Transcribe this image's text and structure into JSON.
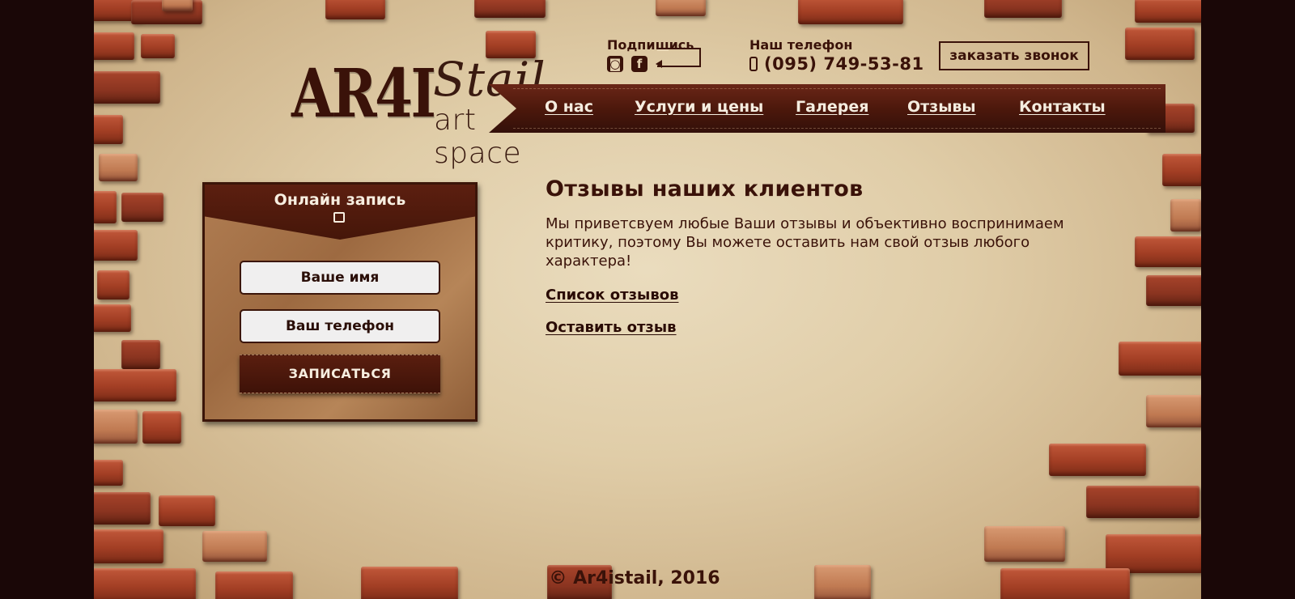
{
  "logo": {
    "main": "AR4I",
    "stail": "Stail",
    "sub": "art space"
  },
  "subscribe": {
    "title": "Подпишись",
    "icons": [
      "instagram-icon",
      "facebook-icon"
    ],
    "instagram_glyph": "◙",
    "facebook_glyph": "f"
  },
  "contact": {
    "title": "Наш телефон",
    "number": "(095) 749-53-81"
  },
  "callback_label": "заказать звонок",
  "nav": {
    "items": [
      {
        "label": "О нас"
      },
      {
        "label": "Услуги и цены"
      },
      {
        "label": "Галерея"
      },
      {
        "label": "Отзывы"
      },
      {
        "label": "Контакты"
      }
    ]
  },
  "form": {
    "title": "Онлайн запись",
    "name_placeholder": "Ваше имя",
    "phone_placeholder": "Ваш телефон",
    "submit_label": "ЗАПИСАТЬСЯ"
  },
  "content": {
    "title": "Отзывы наших клиентов",
    "text": "Мы приветсвуем любые Ваши отзывы и объективно воспринимаем критику, поэтому Вы можете оставить нам свой отзыв любого характера!",
    "links": [
      {
        "label": "Список отзывов"
      },
      {
        "label": "Оставить отзыв"
      }
    ]
  },
  "footer": "© Ar4istail, 2016",
  "colors": {
    "accent": "#3a1209",
    "ribbon": "#4a170b",
    "paper": "#e6d5b3",
    "brick": "#a23e24",
    "outer": "#1a0707"
  }
}
